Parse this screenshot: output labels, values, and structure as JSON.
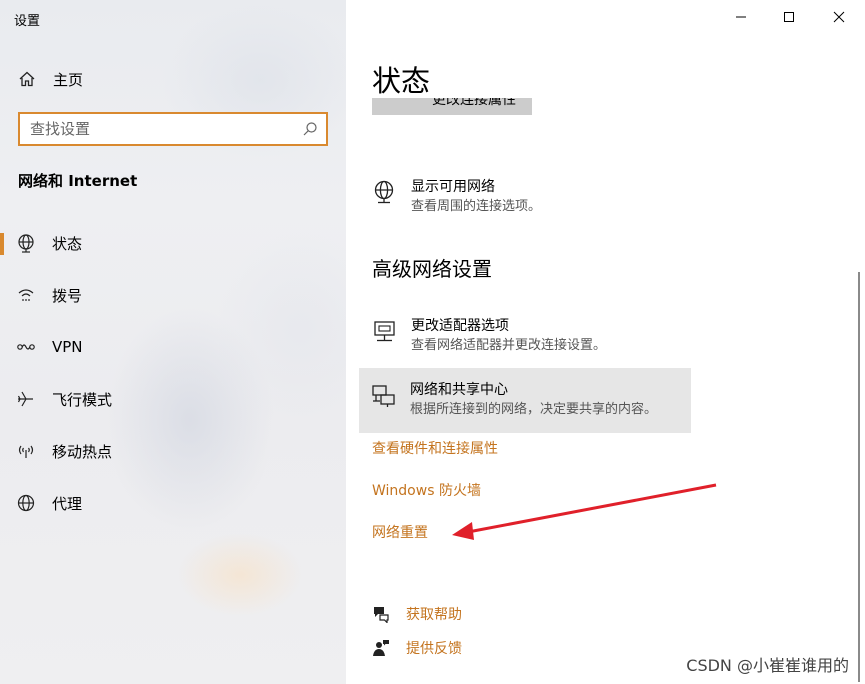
{
  "window": {
    "title": "设置"
  },
  "sidebar": {
    "home_label": "主页",
    "search_placeholder": "查找设置",
    "section_title": "网络和 Internet",
    "items": [
      {
        "label": "状态",
        "icon": "globe-status-icon",
        "active": true
      },
      {
        "label": "拨号",
        "icon": "dialup-icon",
        "active": false
      },
      {
        "label": "VPN",
        "icon": "vpn-icon",
        "active": false
      },
      {
        "label": "飞行模式",
        "icon": "airplane-icon",
        "active": false
      },
      {
        "label": "移动热点",
        "icon": "hotspot-icon",
        "active": false
      },
      {
        "label": "代理",
        "icon": "globe-icon",
        "active": false
      }
    ]
  },
  "main": {
    "title": "状态",
    "cut_button_label": "更改连接属性",
    "show_networks": {
      "title": "显示可用网络",
      "subtitle": "查看周围的连接选项。"
    },
    "advanced_heading": "高级网络设置",
    "adapter_options": {
      "title": "更改适配器选项",
      "subtitle": "查看网络适配器并更改连接设置。"
    },
    "sharing_center": {
      "title": "网络和共享中心",
      "subtitle": "根据所连接到的网络，决定要共享的内容。"
    },
    "links": {
      "hardware": "查看硬件和连接属性",
      "firewall": "Windows 防火墙",
      "reset": "网络重置"
    },
    "help": {
      "get_help": "获取帮助",
      "feedback": "提供反馈"
    }
  },
  "watermark": "CSDN @小崔崔谁用的",
  "colors": {
    "accent": "#c4741f",
    "search_border": "#d9892f",
    "arrow": "#e0202a"
  }
}
